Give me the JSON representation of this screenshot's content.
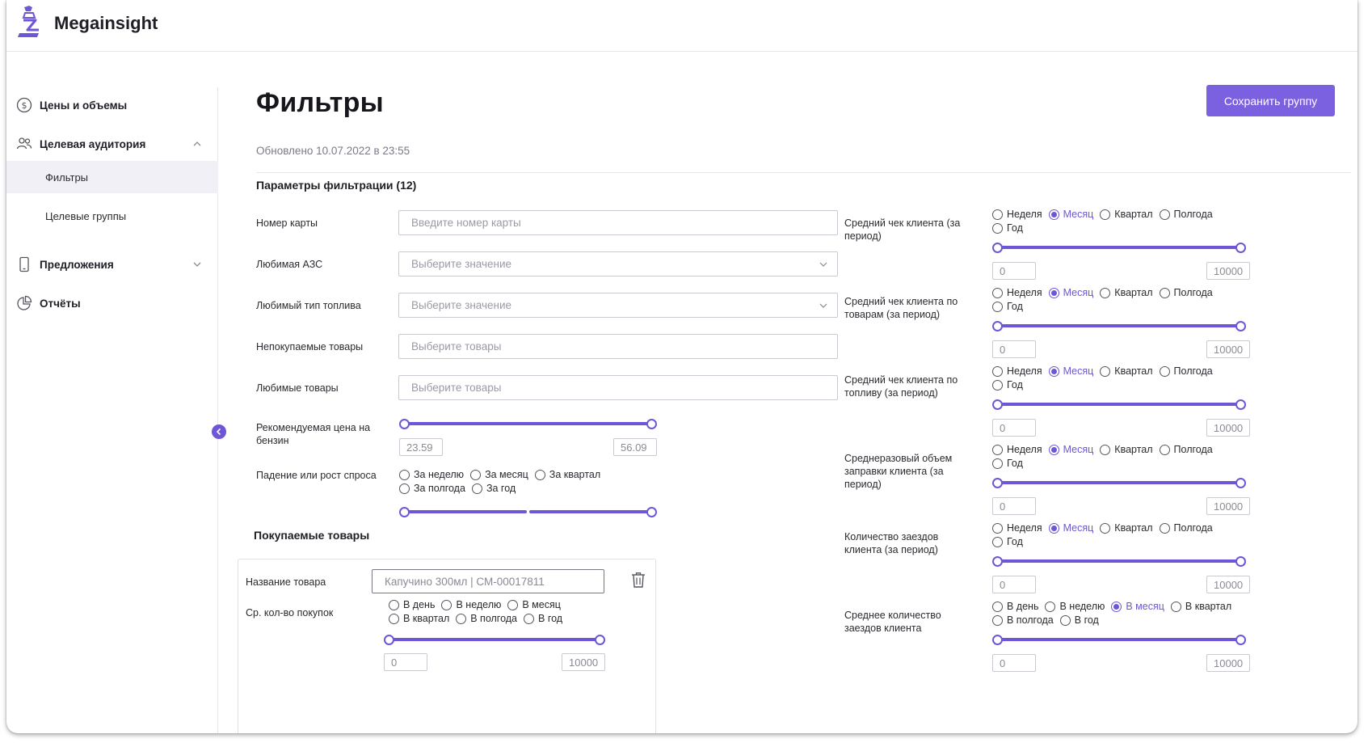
{
  "app": {
    "brand": "Megainsight"
  },
  "sidebar": {
    "items": [
      {
        "label": "Цены и объемы",
        "icon": "dollar-circle-icon"
      },
      {
        "label": "Целевая аудитория",
        "icon": "users-icon",
        "expanded": true
      },
      {
        "label": "Предложения",
        "icon": "phone-icon",
        "expanded": false
      },
      {
        "label": "Отчёты",
        "icon": "pie-chart-icon"
      }
    ],
    "subitems": [
      {
        "label": "Фильтры",
        "active": true
      },
      {
        "label": "Целевые группы",
        "active": false
      }
    ]
  },
  "page": {
    "title": "Фильтры",
    "save_label": "Сохранить группу",
    "updated": "Обновлено 10.07.2022 в 23:55",
    "params_title": "Параметры фильтрации (12)"
  },
  "left_fields": {
    "card_number": {
      "label": "Номер карты",
      "placeholder": "Введите номер карты"
    },
    "fav_station": {
      "label": "Любимая АЗС",
      "placeholder": "Выберите значение"
    },
    "fav_fuel": {
      "label": "Любимый тип топлива",
      "placeholder": "Выберите значение"
    },
    "not_bought": {
      "label": "Непокупаемые товары",
      "placeholder": "Выберите товары"
    },
    "fav_goods": {
      "label": "Любимые товары",
      "placeholder": "Выберите товары"
    },
    "rec_price": {
      "label": "Рекомендуемая цена на бензин",
      "min": "23.59",
      "max": "56.09"
    },
    "demand": {
      "label": "Падение или рост спроса",
      "options": [
        "За неделю",
        "За месяц",
        "За квартал",
        "За полгода",
        "За год"
      ]
    }
  },
  "bought": {
    "title": "Покупаемые товары",
    "name_label": "Название товара",
    "name_value": "Капучино 300мл | СМ-00017811",
    "freq_label": "Ср. кол-во покупок",
    "freq_options": [
      "В день",
      "В неделю",
      "В месяц",
      "В квартал",
      "В полгода",
      "В год"
    ],
    "min": "0",
    "max": "10000"
  },
  "right_fields": [
    {
      "label": "Средний чек клиента (за период)",
      "options": [
        "Неделя",
        "Месяц",
        "Квартал",
        "Полгода",
        "Год"
      ],
      "selected": 1,
      "min": "0",
      "max": "10000"
    },
    {
      "label": "Средний чек клиента по товарам (за период)",
      "options": [
        "Неделя",
        "Месяц",
        "Квартал",
        "Полгода",
        "Год"
      ],
      "selected": 1,
      "min": "0",
      "max": "10000"
    },
    {
      "label": "Средний чек клиента по топливу (за период)",
      "options": [
        "Неделя",
        "Месяц",
        "Квартал",
        "Полгода",
        "Год"
      ],
      "selected": 1,
      "min": "0",
      "max": "10000"
    },
    {
      "label": "Среднеразовый объем заправки клиента (за период)",
      "options": [
        "Неделя",
        "Месяц",
        "Квартал",
        "Полгода",
        "Год"
      ],
      "selected": 1,
      "min": "0",
      "max": "10000"
    },
    {
      "label": "Количество заездов клиента (за период)",
      "options": [
        "Неделя",
        "Месяц",
        "Квартал",
        "Полгода",
        "Год"
      ],
      "selected": 1,
      "min": "0",
      "max": "10000"
    },
    {
      "label": "Среднее количество заездов клиента",
      "options": [
        "В день",
        "В неделю",
        "В месяц",
        "В квартал",
        "В полгода",
        "В год"
      ],
      "selected": 2,
      "min": "0",
      "max": "10000"
    }
  ],
  "colors": {
    "accent": "#6e56d6",
    "button": "#7b61e0"
  }
}
